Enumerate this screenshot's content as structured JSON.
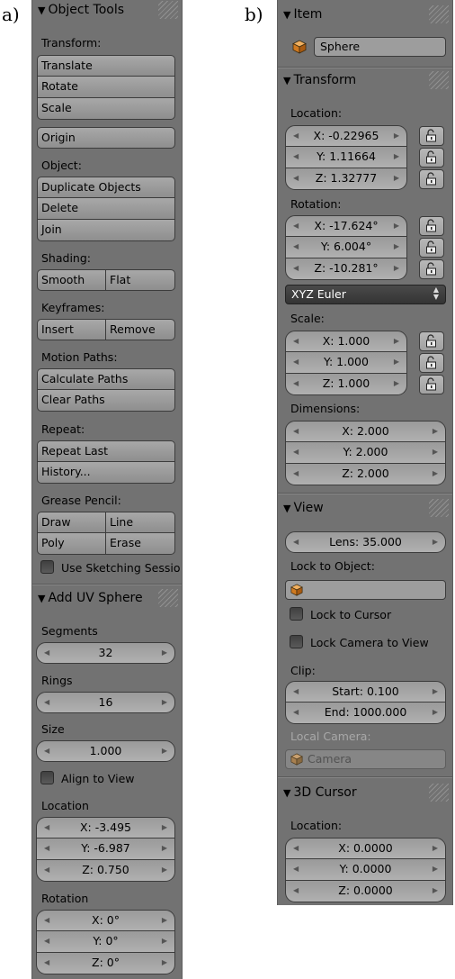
{
  "labels": {
    "a": "a)",
    "b": "b)"
  },
  "panel_a": {
    "object_tools": {
      "title": "Object Tools",
      "transform_label": "Transform:",
      "translate": "Translate",
      "rotate": "Rotate",
      "scale": "Scale",
      "origin": "Origin",
      "object_label": "Object:",
      "duplicate": "Duplicate Objects",
      "delete": "Delete",
      "join": "Join",
      "shading_label": "Shading:",
      "smooth": "Smooth",
      "flat": "Flat",
      "keyframes_label": "Keyframes:",
      "insert": "Insert",
      "remove": "Remove",
      "motion_label": "Motion Paths:",
      "calc_paths": "Calculate Paths",
      "clear_paths": "Clear Paths",
      "repeat_label": "Repeat:",
      "repeat_last": "Repeat Last",
      "history": "History...",
      "grease_label": "Grease Pencil:",
      "draw": "Draw",
      "line": "Line",
      "poly": "Poly",
      "erase": "Erase",
      "sketching": "Use Sketching Sessio"
    },
    "add_uv_sphere": {
      "title": "Add UV Sphere",
      "segments_label": "Segments",
      "segments": "32",
      "rings_label": "Rings",
      "rings": "16",
      "size_label": "Size",
      "size": "1.000",
      "align": "Align to View",
      "location_label": "Location",
      "loc_x": "X: -3.495",
      "loc_y": "Y: -6.987",
      "loc_z": "Z: 0.750",
      "rotation_label": "Rotation",
      "rot_x": "X: 0°",
      "rot_y": "Y: 0°",
      "rot_z": "Z: 0°"
    }
  },
  "panel_b": {
    "item": {
      "title": "Item",
      "name": "Sphere"
    },
    "transform": {
      "title": "Transform",
      "location_label": "Location:",
      "loc_x": "X: -0.22965",
      "loc_y": "Y: 1.11664",
      "loc_z": "Z: 1.32777",
      "rotation_label": "Rotation:",
      "rot_x": "X: -17.624°",
      "rot_y": "Y: 6.004°",
      "rot_z": "Z: -10.281°",
      "rotation_mode": "XYZ Euler",
      "scale_label": "Scale:",
      "sc_x": "X: 1.000",
      "sc_y": "Y: 1.000",
      "sc_z": "Z: 1.000",
      "dimensions_label": "Dimensions:",
      "dim_x": "X: 2.000",
      "dim_y": "Y: 2.000",
      "dim_z": "Z: 2.000"
    },
    "view": {
      "title": "View",
      "lens": "Lens: 35.000",
      "lock_object_label": "Lock to Object:",
      "lock_cursor": "Lock to Cursor",
      "lock_camera": "Lock Camera to View",
      "clip_label": "Clip:",
      "clip_start": "Start: 0.100",
      "clip_end": "End: 1000.000",
      "local_camera_label": "Local Camera:",
      "camera_placeholder": "Camera"
    },
    "cursor": {
      "title": "3D Cursor",
      "location_label": "Location:",
      "x": "X: 0.0000",
      "y": "Y: 0.0000",
      "z": "Z: 0.0000"
    }
  },
  "icons": {
    "collapse": "triangle-down-icon",
    "lock": "padlock-icon",
    "object": "cube-object-icon"
  },
  "colors": {
    "panel_bg": "#727272",
    "button_bg": "#9d9d9d",
    "dropdown_bg": "#3c3c3c"
  }
}
